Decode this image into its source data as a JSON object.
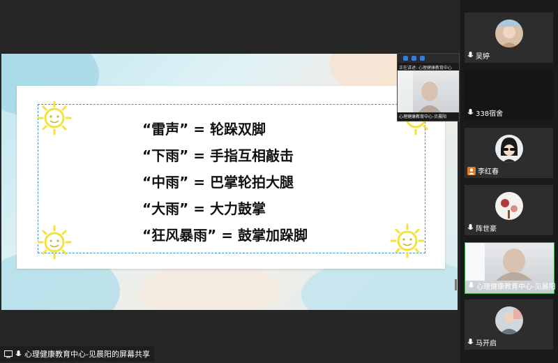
{
  "slide": {
    "lines": [
      "“雷声” = 轮跺双脚",
      "“下雨” = 手指互相敲击",
      "“中雨” = 巴掌轮拍大腿",
      "“大雨” = 大力鼓掌",
      "“狂风暴雨” = 鼓掌加跺脚"
    ]
  },
  "floating_window": {
    "status": "正在讲述: 心理健康教育中心",
    "name": "心理健康教育中心-贝晨阳"
  },
  "bottom_bar": {
    "share_label": "心理健康教育中心-见晨阳的屏幕共享"
  },
  "participants": [
    {
      "name": "吴婷",
      "icon": "mic-icon"
    },
    {
      "name": "338宿舍",
      "icon": "mic-icon"
    },
    {
      "name": "李红春",
      "icon": "user-icon"
    },
    {
      "name": "阵世豪",
      "icon": "mic-icon"
    },
    {
      "name": "心理健康教育中心-见晨阳",
      "icon": "mic-icon"
    },
    {
      "name": "马开启",
      "icon": "mic-icon"
    }
  ],
  "colors": {
    "active_border": "#43b05c",
    "sun_yellow": "#f2e23c",
    "dash_blue": "#3a8ed6"
  }
}
